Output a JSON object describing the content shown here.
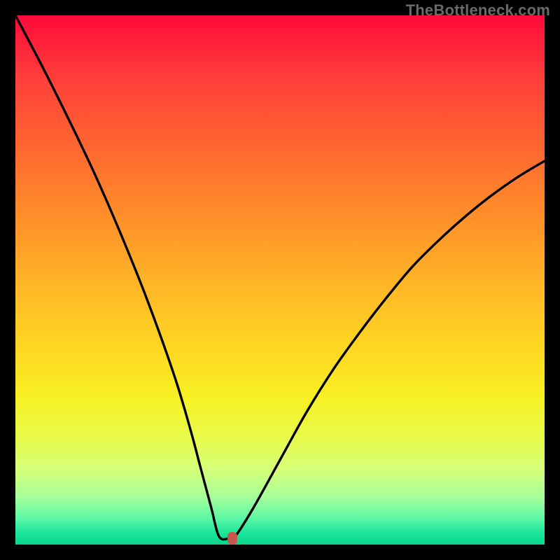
{
  "attribution": "TheBottleneck.com",
  "chart_data": {
    "type": "line",
    "title": "",
    "xlabel": "",
    "ylabel": "",
    "xlim": [
      0,
      100
    ],
    "ylim": [
      0,
      100
    ],
    "grid": false,
    "legend": false,
    "series": [
      {
        "name": "bottleneck-curve",
        "x": [
          0,
          5,
          10,
          15,
          20,
          25,
          30,
          33,
          35,
          37,
          38.5,
          40.5,
          41.5,
          45,
          50,
          55,
          60,
          65,
          70,
          75,
          80,
          85,
          90,
          95,
          100
        ],
        "values": [
          100,
          90.5,
          80.5,
          70,
          58.5,
          46,
          32,
          22,
          14.5,
          7,
          1.5,
          1.2,
          1.5,
          7,
          16,
          25,
          33,
          40,
          46.5,
          52.5,
          57.5,
          62,
          66,
          69.5,
          72.5
        ]
      }
    ],
    "marker": {
      "x": 41,
      "y": 1.2,
      "color": "#c9564a"
    },
    "gradient_stops": [
      {
        "pct": 0,
        "color": "#ff0a3a"
      },
      {
        "pct": 12,
        "color": "#ff3f3a"
      },
      {
        "pct": 26,
        "color": "#ff6a2f"
      },
      {
        "pct": 38,
        "color": "#ff8f2a"
      },
      {
        "pct": 50,
        "color": "#ffb327"
      },
      {
        "pct": 62,
        "color": "#ffd423"
      },
      {
        "pct": 72,
        "color": "#f7f022"
      },
      {
        "pct": 80,
        "color": "#e8fb4d"
      },
      {
        "pct": 86,
        "color": "#d4ff7a"
      },
      {
        "pct": 91,
        "color": "#a6ff9a"
      },
      {
        "pct": 95,
        "color": "#5cf7a5"
      },
      {
        "pct": 98,
        "color": "#17e59a"
      },
      {
        "pct": 100,
        "color": "#09d48e"
      }
    ]
  }
}
